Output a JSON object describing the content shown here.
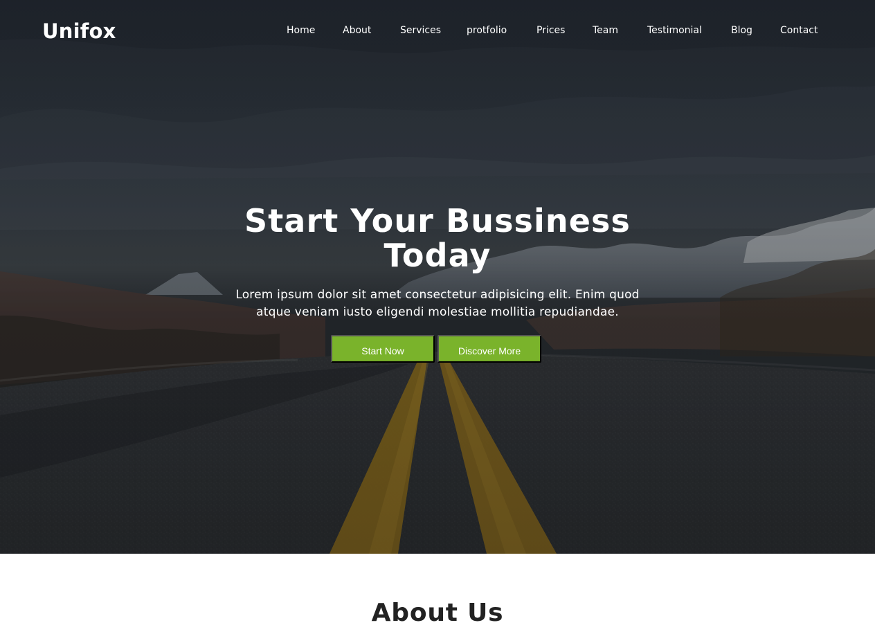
{
  "brand": {
    "name": "Unifox"
  },
  "nav": {
    "items": [
      "Home",
      "About",
      "Services",
      "protfolio",
      "Prices",
      "Team",
      "Testimonial",
      "Blog",
      "Contact"
    ]
  },
  "hero": {
    "title_line_1": "Start Your Bussiness",
    "title_line_2": "Today",
    "subtitle_line_1": "Lorem ipsum dolor sit amet consectetur adipisicing elit. Enim quod",
    "subtitle_line_2": "atque veniam iusto eligendi molestiae mollitia repudiandae.",
    "buttons": {
      "start": "Start Now",
      "discover": "Discover More"
    }
  },
  "about": {
    "title": "About Us"
  },
  "colors": {
    "accent": "#7ab32b",
    "hero_text": "#ffffff",
    "page_background": "#ffffff",
    "heading_text": "#222222"
  }
}
